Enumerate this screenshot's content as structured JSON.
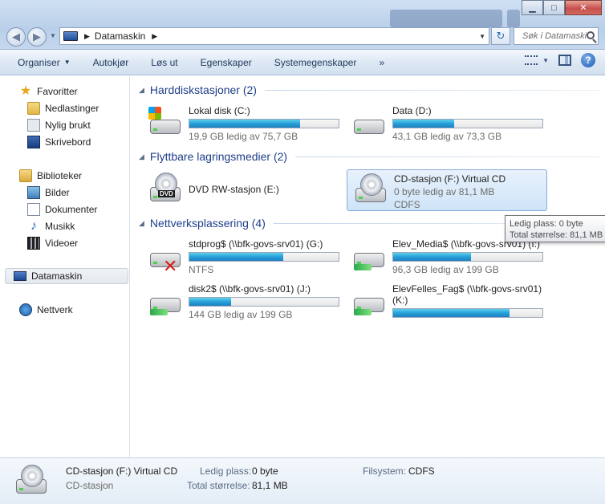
{
  "window": {
    "minimize_glyph": "▁",
    "maximize_glyph": "□",
    "close_glyph": "✕"
  },
  "nav": {
    "back_glyph": "◀",
    "forward_glyph": "▶",
    "history_glyph": "▼"
  },
  "address": {
    "location": "Datamaskin",
    "sep_glyph": "▶",
    "dropdown_glyph": "▼",
    "refresh_glyph": "↻",
    "search_placeholder": "Søk i Datamaskin"
  },
  "toolbar": {
    "organize": "Organiser",
    "autoplay": "Autokjør",
    "eject": "Løs ut",
    "properties": "Egenskaper",
    "system_properties": "Systemegenskaper",
    "more": "»",
    "caret": "▼",
    "help": "?"
  },
  "sidebar": {
    "favorites": "Favoritter",
    "downloads": "Nedlastinger",
    "recent": "Nylig brukt",
    "desktop": "Skrivebord",
    "libraries": "Biblioteker",
    "pictures": "Bilder",
    "documents": "Dokumenter",
    "music": "Musikk",
    "videos": "Videoer",
    "computer": "Datamaskin",
    "network": "Nettverk",
    "star_glyph": "★",
    "note_glyph": "♪"
  },
  "groups": {
    "hdd": "Harddiskstasjoner (2)",
    "removable": "Flyttbare lagringsmedier (2)",
    "network": "Nettverksplassering (4)",
    "arrow_glyph": "◢"
  },
  "drives": {
    "c": {
      "name": "Lokal disk (C:)",
      "info": "19,9 GB ledig av 75,7 GB",
      "used_fraction": 0.74
    },
    "d": {
      "name": "Data (D:)",
      "info": "43,1 GB ledig av 73,3 GB",
      "used_fraction": 0.41
    },
    "e": {
      "name": "DVD RW-stasjon (E:)",
      "dvd_label": "DVD"
    },
    "f": {
      "name": "CD-stasjon (F:) Virtual CD",
      "info": "0 byte ledig av 81,1 MB",
      "fs": "CDFS"
    },
    "g": {
      "name": "stdprog$ (\\\\bfk-govs-srv01) (G:)",
      "info": "NTFS",
      "used_fraction": 0.63,
      "x_glyph": "✕"
    },
    "i": {
      "name": "Elev_Media$ (\\\\bfk-govs-srv01) (I:)",
      "info": "96,3 GB ledig av 199 GB",
      "used_fraction": 0.52
    },
    "j": {
      "name": "disk2$ (\\\\bfk-govs-srv01) (J:)",
      "info": "144 GB ledig av 199 GB",
      "used_fraction": 0.28
    },
    "k": {
      "name": "ElevFelles_Fag$ (\\\\bfk-govs-srv01)",
      "name2": "(K:)",
      "used_fraction": 0.78
    }
  },
  "tooltip": {
    "line1": "Ledig plass: 0 byte",
    "line2": "Total størrelse: 81,1 MB"
  },
  "details": {
    "name": "CD-stasjon (F:) Virtual CD",
    "type": "CD-stasjon",
    "free_label": "Ledig plass:",
    "free_value": "0 byte",
    "total_label": "Total størrelse:",
    "total_value": "81,1 MB",
    "fs_label": "Filsystem:",
    "fs_value": "CDFS"
  }
}
